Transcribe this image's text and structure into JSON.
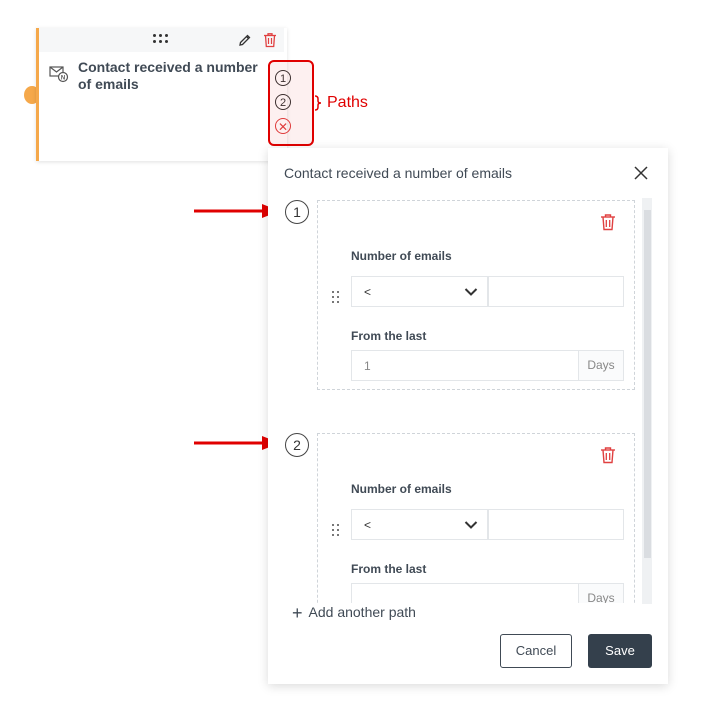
{
  "node": {
    "title": "Contact received a number of emails",
    "path_markers": [
      "1",
      "2",
      "✕"
    ]
  },
  "annotation": {
    "paths_label": "Paths",
    "color": "#e00000"
  },
  "modal": {
    "title": "Contact received a number of emails",
    "paths": [
      {
        "number": "1",
        "number_of_emails_label": "Number of emails",
        "operator": "<",
        "count_value": "",
        "from_the_last_label": "From the last",
        "from_the_last_value": "1",
        "unit": "Days"
      },
      {
        "number": "2",
        "number_of_emails_label": "Number of emails",
        "operator": "<",
        "count_value": "",
        "from_the_last_label": "From the last",
        "from_the_last_value": "",
        "unit": "Days"
      }
    ],
    "add_path_label": "Add another path",
    "cancel_label": "Cancel",
    "save_label": "Save"
  },
  "colors": {
    "accent": "#f5a84a",
    "danger": "#e04040",
    "primary_button": "#34404c"
  },
  "icons": [
    "drag-icon",
    "pencil-icon",
    "trash-icon",
    "email-icon",
    "close-icon",
    "chevron-down-icon",
    "plus-icon",
    "arrow-icon"
  ]
}
